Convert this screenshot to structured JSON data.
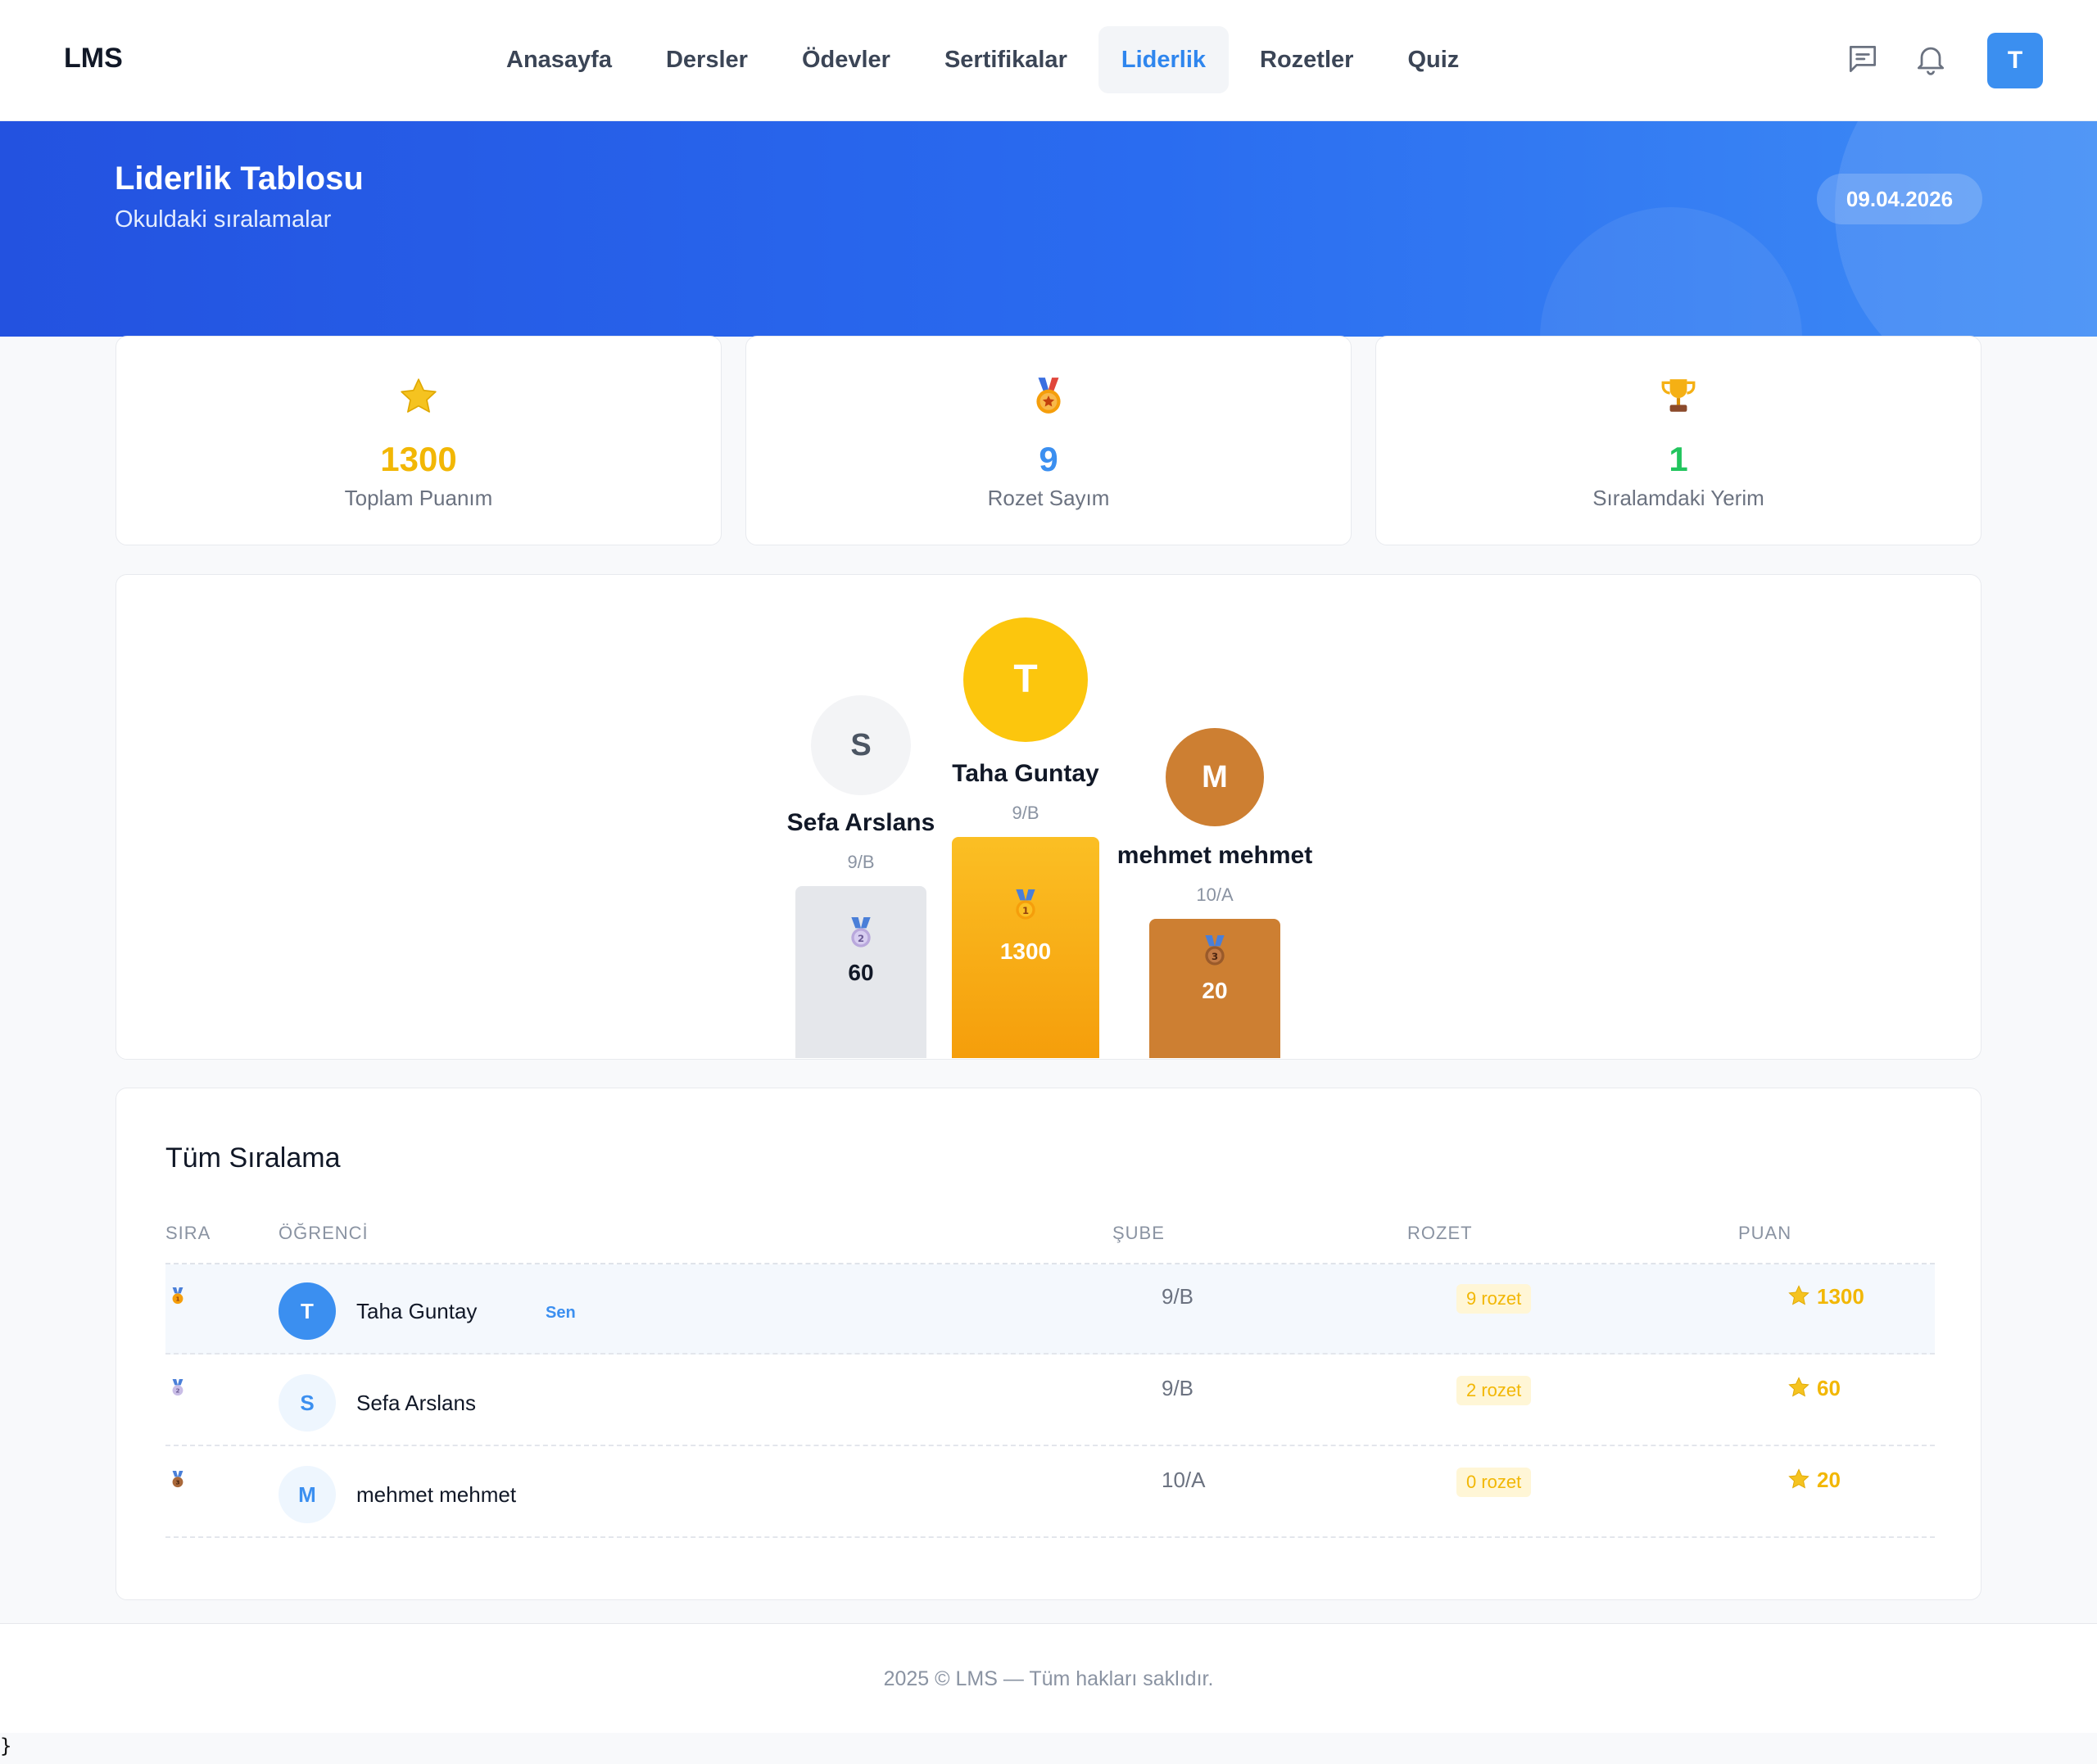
{
  "brand": "LMS",
  "nav": {
    "items": [
      {
        "label": "Anasayfa"
      },
      {
        "label": "Dersler"
      },
      {
        "label": "Ödevler"
      },
      {
        "label": "Sertifikalar"
      },
      {
        "label": "Liderlik"
      },
      {
        "label": "Rozetler"
      },
      {
        "label": "Quiz"
      }
    ],
    "active": "Liderlik",
    "user_initial": "T"
  },
  "hero": {
    "title": "Liderlik Tablosu",
    "subtitle": "Okuldaki sıralamalar",
    "date": "09.04.2026"
  },
  "stats": [
    {
      "icon": "star-icon",
      "value": "1300",
      "label": "Toplam Puanım",
      "color": "#f2b705"
    },
    {
      "icon": "medal-icon",
      "value": "9",
      "label": "Rozet Sayım",
      "color": "#3b8ff0"
    },
    {
      "icon": "trophy-icon",
      "value": "1",
      "label": "Sıralamdaki Yerim",
      "color": "#22c55e"
    }
  ],
  "podium": {
    "first": {
      "initial": "T",
      "name": "Taha Guntay",
      "class": "9/B",
      "points": "1300",
      "rank": 1
    },
    "second": {
      "initial": "S",
      "name": "Sefa Arslans",
      "class": "9/B",
      "points": "60",
      "rank": 2
    },
    "third": {
      "initial": "M",
      "name": "mehmet mehmet",
      "class": "10/A",
      "points": "20",
      "rank": 3
    }
  },
  "table": {
    "title": "Tüm Sıralama",
    "columns": [
      "SIRA",
      "ÖĞRENCİ",
      "ŞUBE",
      "ROZET",
      "PUAN"
    ],
    "rows": [
      {
        "rank": 1,
        "initial": "T",
        "name": "Taha Guntay",
        "you_badge": "Sen",
        "class": "9/B",
        "badges": "9 rozet",
        "points": "1300"
      },
      {
        "rank": 2,
        "initial": "S",
        "name": "Sefa Arslans",
        "class": "9/B",
        "badges": "2 rozet",
        "points": "60"
      },
      {
        "rank": 3,
        "initial": "M",
        "name": "mehmet mehmet",
        "class": "10/A",
        "badges": "0 rozet",
        "points": "20"
      }
    ]
  },
  "footer": "2025 © LMS — Tüm hakları saklıdır.",
  "stray_text": "}",
  "colors": {
    "primary": "#3b8ff0",
    "gold": "#f2b705",
    "silver_block": "#e5e7eb",
    "bronze": "#cd7f32",
    "hero_start": "#2352e0",
    "hero_end": "#3e8cf5"
  }
}
